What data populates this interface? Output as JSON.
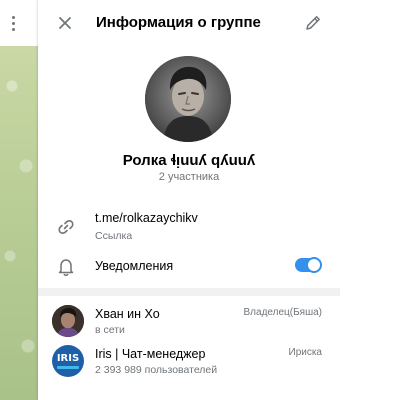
{
  "header": {
    "title": "Информация о группе"
  },
  "group": {
    "name": "Ролка ɬᴉuuʎ qʎuuʎ",
    "members_count": "2 участника"
  },
  "link": {
    "url": "t.me/rolkazaychikv",
    "label": "Ссылка"
  },
  "notifications": {
    "label": "Уведомления",
    "enabled": true
  },
  "members": [
    {
      "name": "Хван ин Хо",
      "status": "в сети",
      "role": "Владелец(Бяша)"
    },
    {
      "name": "Iris | Чат-менеджер",
      "status": "2 393 989 пользователей",
      "role": "Ириска",
      "avatar_text": "IRIS"
    }
  ],
  "colors": {
    "accent": "#3390ec",
    "secondary_text": "#707579"
  },
  "icons": [
    "more-vertical-icon",
    "close-icon",
    "pencil-icon",
    "link-icon",
    "bell-icon"
  ]
}
